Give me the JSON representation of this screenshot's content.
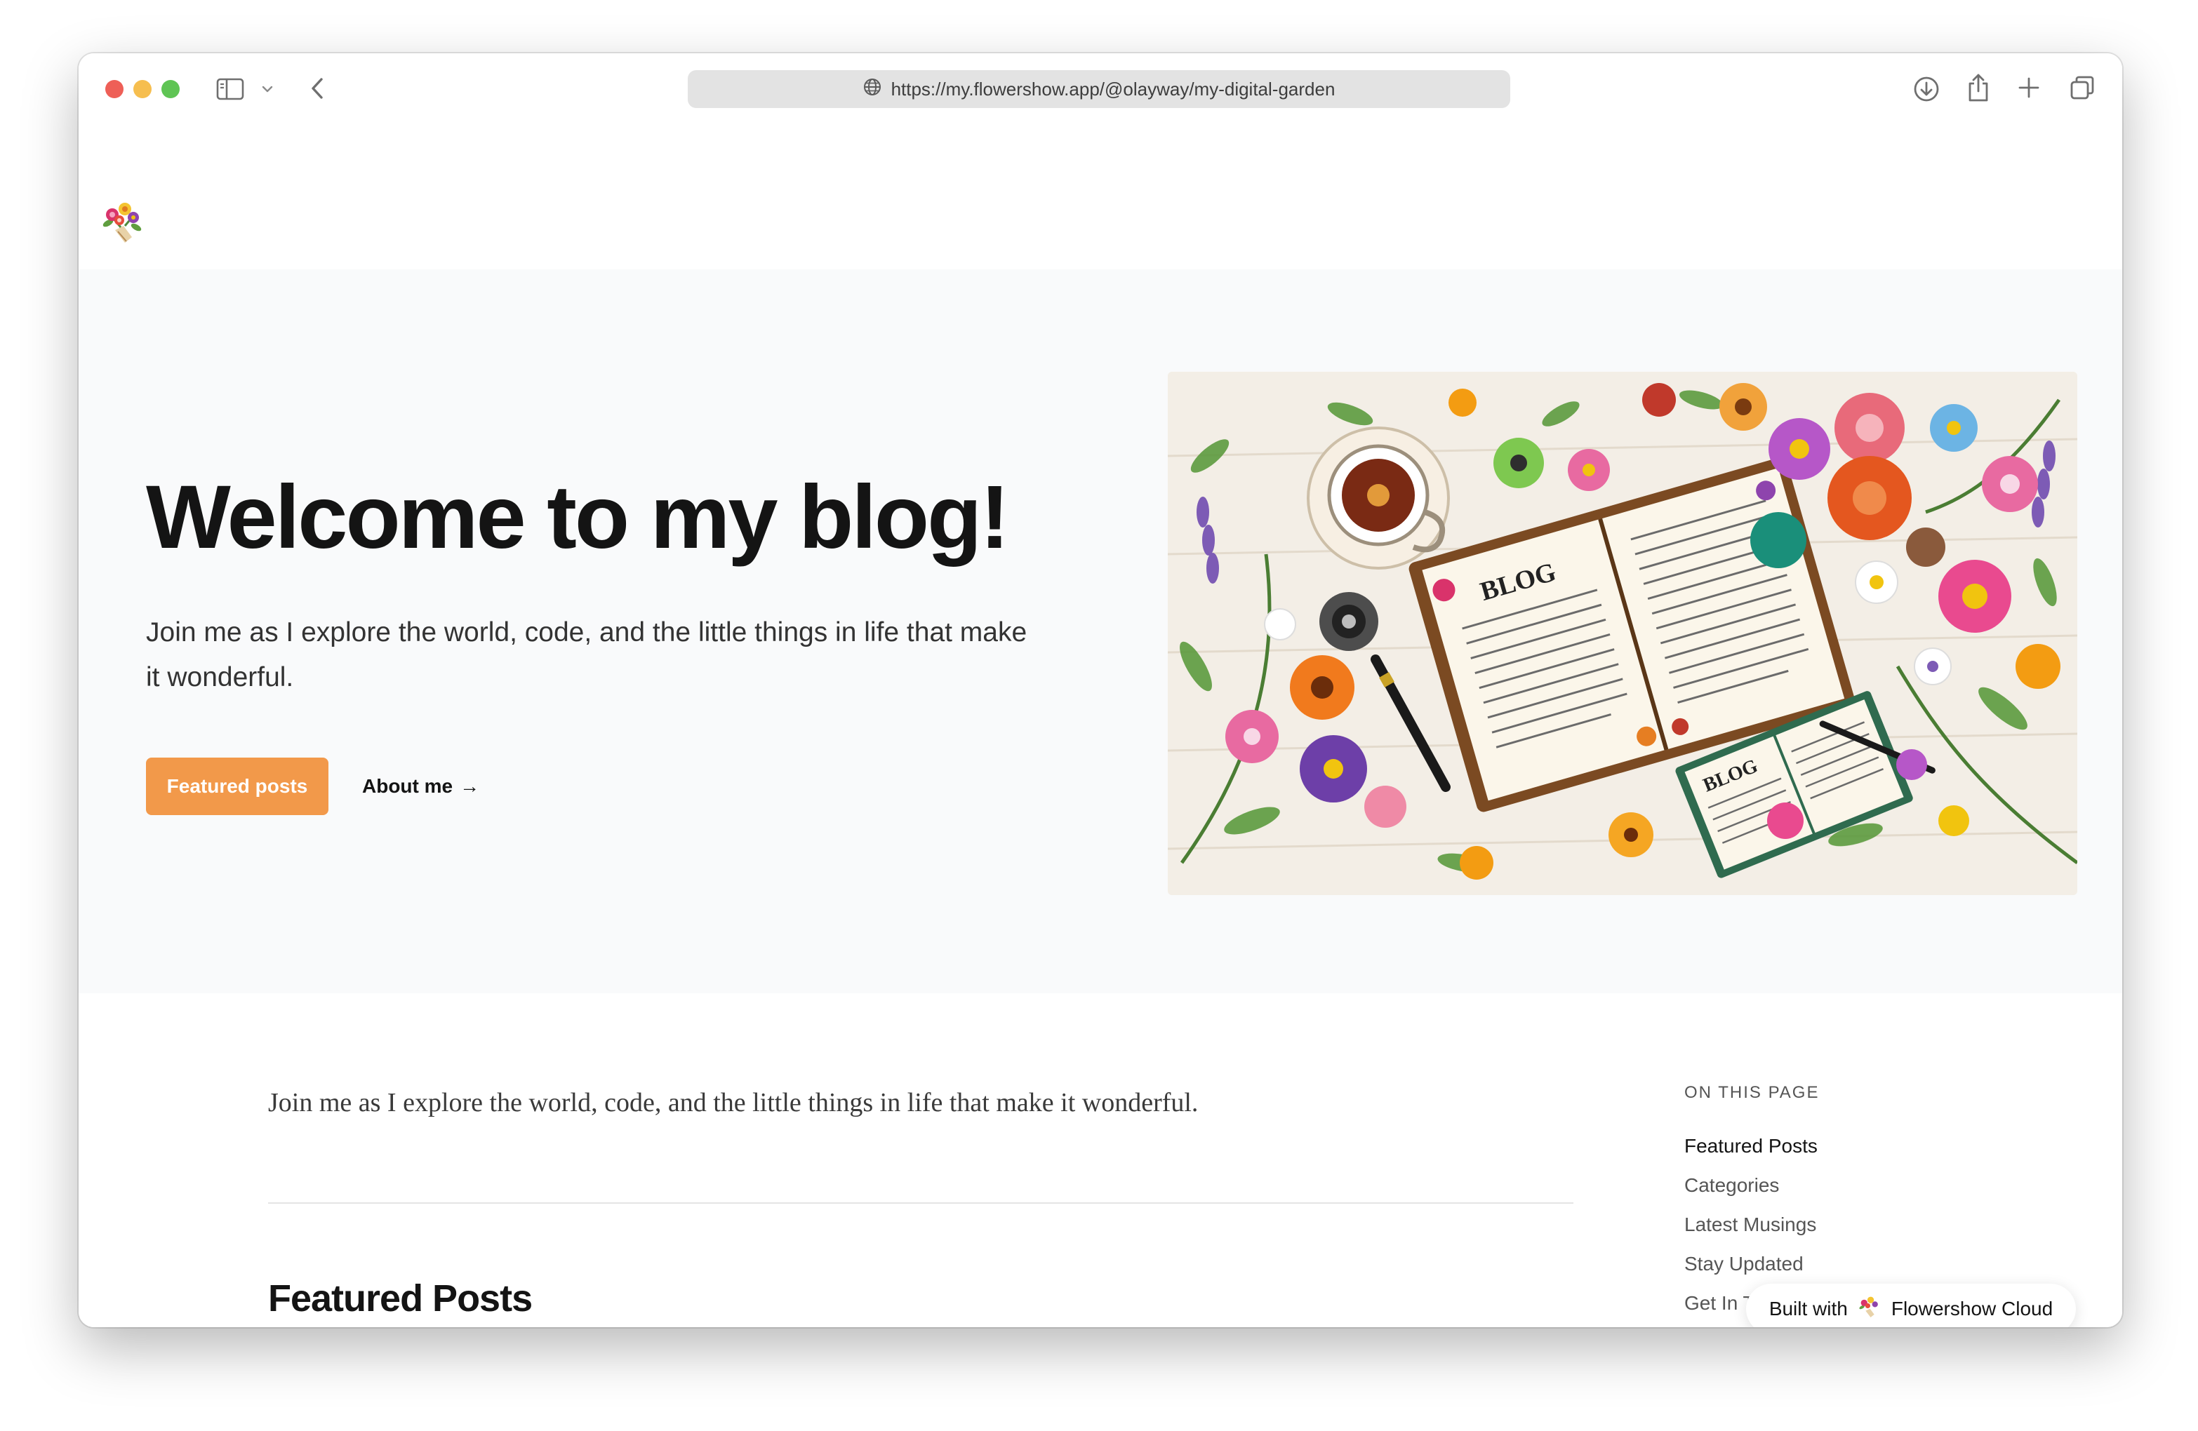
{
  "browser": {
    "url": "https://my.flowershow.app/@olayway/my-digital-garden"
  },
  "hero": {
    "title": "Welcome to my blog!",
    "subtitle": "Join me as I explore the world, code, and the little things in life that make it wonderful.",
    "primary_button": "Featured posts",
    "secondary_link": "About me",
    "secondary_arrow": "→",
    "image_text_1": "BLOG",
    "image_text_2": "BLOG"
  },
  "content": {
    "intro": "Join me as I explore the world, code, and the little things in life that make it wonderful.",
    "section_title": "Featured Posts"
  },
  "toc": {
    "heading": "ON THIS PAGE",
    "items": [
      {
        "label": "Featured Posts"
      },
      {
        "label": "Categories"
      },
      {
        "label": "Latest Musings"
      },
      {
        "label": "Stay Updated"
      },
      {
        "label": "Get In T"
      }
    ]
  },
  "badge": {
    "prefix": "Built with",
    "name": "Flowershow Cloud"
  },
  "colors": {
    "accent": "#f2994a",
    "hero_bg": "#f9fafb",
    "text": "#141414"
  },
  "icons": [
    "sidebar-icon",
    "chevron-down-icon",
    "back-icon",
    "globe-icon",
    "download-icon",
    "share-icon",
    "plus-icon",
    "tabs-icon",
    "flower-logo-icon"
  ]
}
